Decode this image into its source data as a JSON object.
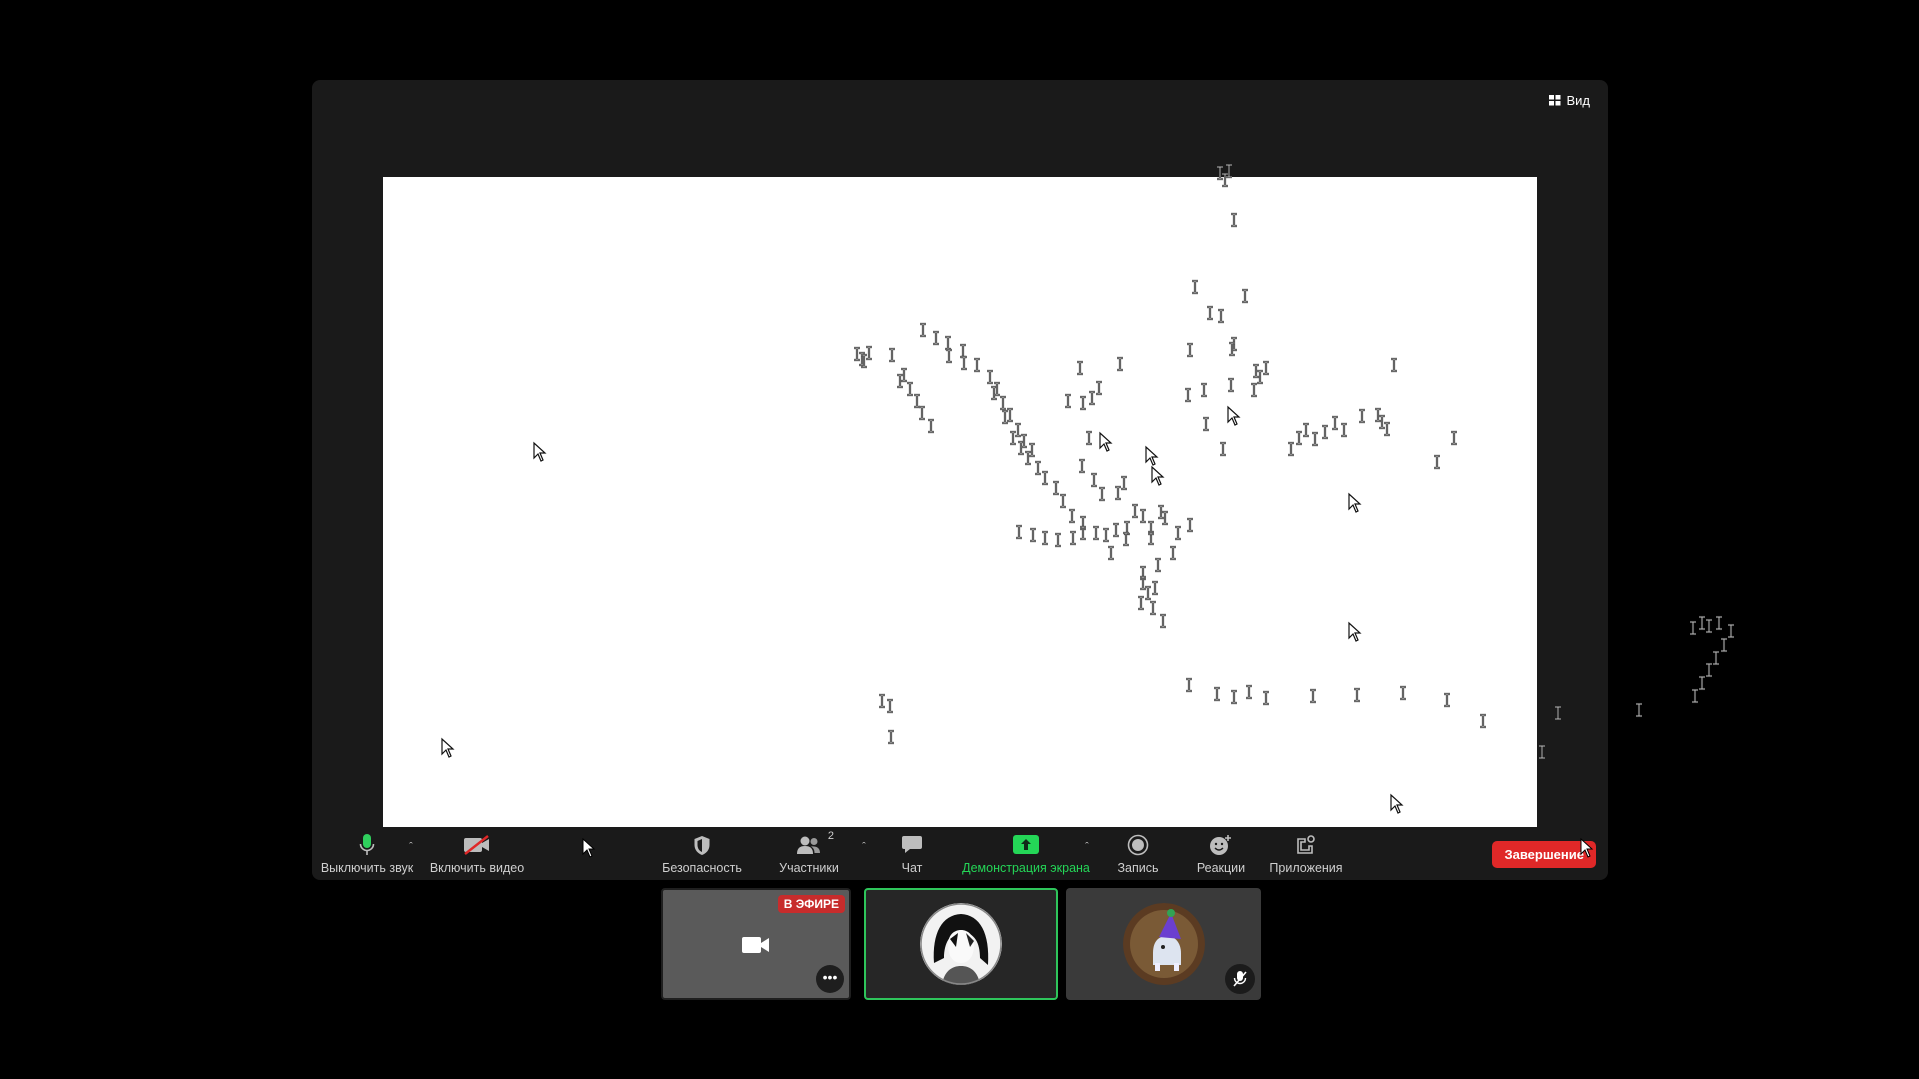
{
  "window": {
    "view_label": "Вид"
  },
  "toolbar": {
    "mute_label": "Выключить звук",
    "video_label": "Включить видео",
    "security_label": "Безопасность",
    "participants_label": "Участники",
    "participants_count": "2",
    "chat_label": "Чат",
    "share_label": "Демонстрация экрана",
    "record_label": "Запись",
    "reactions_label": "Реакции",
    "apps_label": "Приложения",
    "end_label": "Завершение"
  },
  "thumbnails": {
    "live_badge": "В ЭФИРЕ"
  },
  "colors": {
    "accent_green": "#24d657",
    "end_red": "#e02828",
    "live_red": "#c72c2c",
    "canvas": "#ffffff",
    "window_bg": "#1a1a1a"
  },
  "icons": [
    "grid-icon",
    "microphone-icon",
    "video-off-icon",
    "shield-icon",
    "participants-icon",
    "chat-icon",
    "share-screen-icon",
    "record-icon",
    "reactions-icon",
    "apps-icon",
    "camera-icon",
    "more-icon",
    "mic-off-icon",
    "cursor-icon",
    "text-cursor-icon"
  ]
}
